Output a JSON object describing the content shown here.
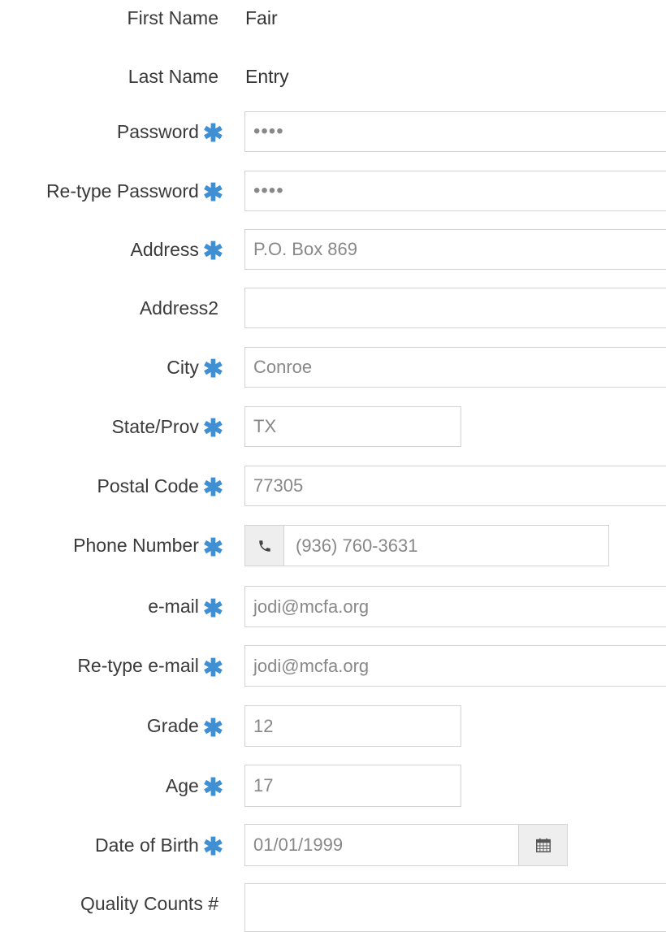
{
  "form": {
    "first_name": {
      "label": "First Name",
      "value": "Fair"
    },
    "last_name": {
      "label": "Last Name",
      "value": "Entry"
    },
    "password": {
      "label": "Password",
      "value": "••••"
    },
    "retype_password": {
      "label": "Re-type Password",
      "value": "••••"
    },
    "address": {
      "label": "Address",
      "value": "P.O. Box 869"
    },
    "address2": {
      "label": "Address2",
      "value": ""
    },
    "city": {
      "label": "City",
      "value": "Conroe"
    },
    "state": {
      "label": "State/Prov",
      "value": "TX"
    },
    "postal": {
      "label": "Postal Code",
      "value": "77305"
    },
    "phone": {
      "label": "Phone Number",
      "value": "(936) 760-3631"
    },
    "email": {
      "label": "e-mail",
      "value": "jodi@mcfa.org"
    },
    "retype_email": {
      "label": "Re-type e-mail",
      "value": "jodi@mcfa.org"
    },
    "grade": {
      "label": "Grade",
      "value": "12"
    },
    "age": {
      "label": "Age",
      "value": "17"
    },
    "dob": {
      "label": "Date of Birth",
      "value": "01/01/1999"
    },
    "quality_counts": {
      "label": "Quality Counts #",
      "value": ""
    }
  },
  "required_marker": "✱",
  "icons": {
    "phone": "phone-icon",
    "calendar": "calendar-icon",
    "required": "asterisk-icon"
  },
  "colors": {
    "required": "#3f8fd2",
    "border": "#d3d3d3",
    "addon_bg": "#eeeeee"
  }
}
